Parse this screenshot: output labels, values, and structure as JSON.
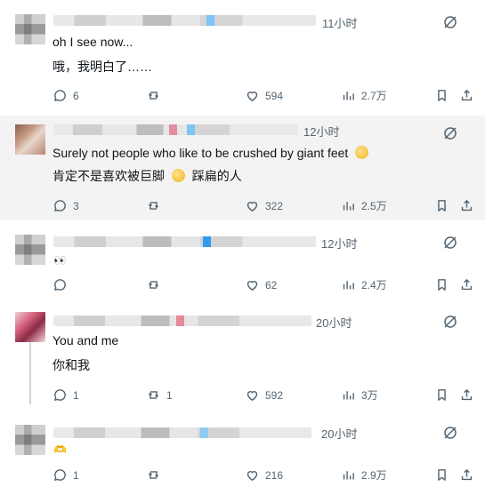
{
  "posts": [
    {
      "time": "11小时",
      "line1": "oh I see now...",
      "line2": "哦，我明白了……",
      "counts": {
        "replies": "6",
        "reposts": "",
        "likes": "594",
        "views": "2.7万"
      }
    },
    {
      "time": "12小时",
      "line1": "Surely not people who like to be crushed by giant feet",
      "line2_a": "肯定不是喜欢被巨脚",
      "line2_b": "踩扁的人",
      "counts": {
        "replies": "3",
        "reposts": "",
        "likes": "322",
        "views": "2.5万"
      }
    },
    {
      "time": "12小时",
      "line1": "👀",
      "counts": {
        "replies": "",
        "reposts": "",
        "likes": "62",
        "views": "2.4万"
      }
    },
    {
      "time": "20小时",
      "line1": "You and me",
      "line2": "你和我",
      "counts": {
        "replies": "1",
        "reposts": "1",
        "likes": "592",
        "views": "3万"
      }
    },
    {
      "time": "20小时",
      "line1": "🫶",
      "counts": {
        "replies": "1",
        "reposts": "",
        "likes": "216",
        "views": "2.9万"
      }
    }
  ],
  "icons": {
    "reply": "reply-icon",
    "repost": "repost-icon",
    "like": "heart-icon",
    "views": "views-chart-icon",
    "bookmark": "bookmark-icon",
    "share": "share-icon",
    "grok": "grok-icon"
  },
  "colors": {
    "text": "#0f1419",
    "muted": "#536471",
    "highlightBg": "#f3f3f3",
    "thread": "#cfd9de"
  }
}
